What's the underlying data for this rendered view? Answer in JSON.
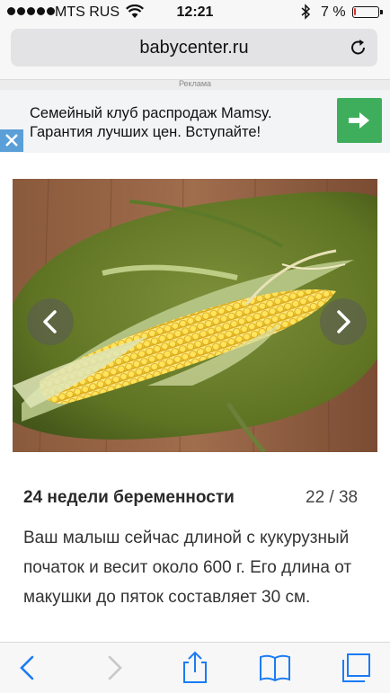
{
  "status_bar": {
    "carrier": "MTS RUS",
    "time": "12:21",
    "battery_percent": "7 %",
    "battery_level": 0.07,
    "battery_color": "#e0302a",
    "icons": [
      "signal-dots",
      "wifi-icon",
      "bluetooth-icon",
      "battery-icon"
    ]
  },
  "browser": {
    "url": "babycenter.ru",
    "reload_icon": "reload-icon",
    "ad_label": "Реклама"
  },
  "ad_banner": {
    "line1": "Семейный клуб распродаж Mamsy.",
    "line2": "Гарантия лучших цен. Вступайте!",
    "action_icon": "arrow-right-icon",
    "action_color": "#3fae5c",
    "close_icon": "close-icon"
  },
  "slideshow": {
    "image": "corn-cob-photo",
    "prev_icon": "chevron-left-icon",
    "next_icon": "chevron-right-icon"
  },
  "article": {
    "title": "24 недели беременности",
    "counter": "22 / 38",
    "text": "Ваш малыш сейчас длиной с кукурузный початок и весит около 600 г. Его длина от макушки до пяток составляет 30 см."
  },
  "toolbar": {
    "icons": [
      "back-icon",
      "forward-icon",
      "share-icon",
      "bookmarks-icon",
      "tabs-icon"
    ],
    "accent": "#1a7cf5"
  }
}
